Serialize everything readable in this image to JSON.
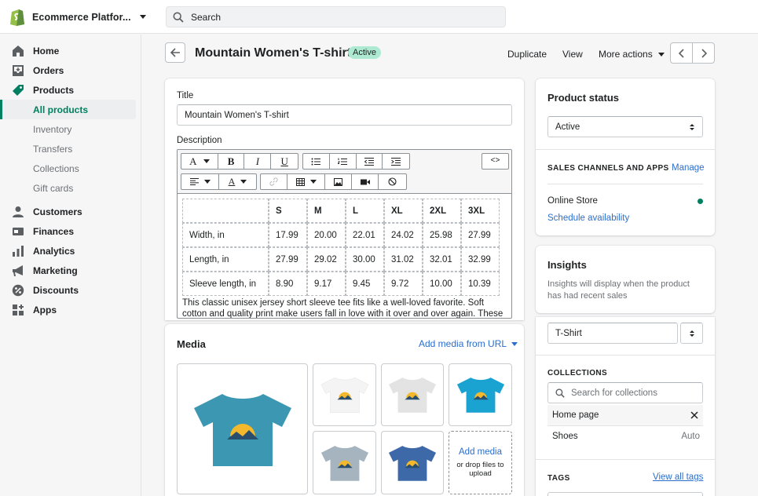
{
  "store": {
    "name": "Ecommerce Platfor..."
  },
  "search": {
    "placeholder": "Search"
  },
  "nav": {
    "home": "Home",
    "orders": "Orders",
    "products": "Products",
    "all_products": "All products",
    "inventory": "Inventory",
    "transfers": "Transfers",
    "collections": "Collections",
    "gift_cards": "Gift cards",
    "customers": "Customers",
    "finances": "Finances",
    "analytics": "Analytics",
    "marketing": "Marketing",
    "discounts": "Discounts",
    "apps": "Apps"
  },
  "header": {
    "title": "Mountain Women's T-shirt",
    "badge": "Active",
    "duplicate": "Duplicate",
    "view": "View",
    "more_actions": "More actions"
  },
  "product": {
    "title_label": "Title",
    "title_value": "Mountain Women's T-shirt",
    "description_label": "Description",
    "size_table": {
      "headers": [
        "",
        "S",
        "M",
        "L",
        "XL",
        "2XL",
        "3XL"
      ],
      "rows": [
        [
          "Width, in",
          "17.99",
          "20.00",
          "22.01",
          "24.02",
          "25.98",
          "27.99"
        ],
        [
          "Length, in",
          "27.99",
          "29.02",
          "30.00",
          "31.02",
          "32.01",
          "32.99"
        ],
        [
          "Sleeve length, in",
          "8.90",
          "9.17",
          "9.45",
          "9.72",
          "10.00",
          "10.39"
        ]
      ]
    },
    "description_text": "This classic unisex jersey short sleeve tee fits like a well-loved favorite. Soft cotton and quality print make users fall in love with it over and over again. These"
  },
  "media": {
    "heading": "Media",
    "add_from_url": "Add media from URL",
    "add_media": "Add media",
    "drop_files": "or drop files to upload",
    "colors": {
      "main": "#3c97b3",
      "white": "#f4f4f4",
      "grey": "#e3e3e3",
      "turquoise": "#1aa3d0",
      "slate": "#a5b4bf",
      "royal": "#3d69a8"
    }
  },
  "status": {
    "heading": "Product status",
    "value": "Active",
    "sales_channels": "SALES CHANNELS AND APPS",
    "manage": "Manage",
    "online_store": "Online Store",
    "schedule": "Schedule availability",
    "online_color": "#008060"
  },
  "insights": {
    "heading": "Insights",
    "text": "Insights will display when the product has had recent sales"
  },
  "organization": {
    "type_value": "T-Shirt",
    "collections_heading": "COLLECTIONS",
    "search_placeholder": "Search for collections",
    "collections": [
      {
        "name": "Home page",
        "meta": ""
      },
      {
        "name": "Shoes",
        "meta": "Auto"
      }
    ],
    "tags_heading": "TAGS",
    "view_all_tags": "View all tags"
  },
  "colors": {
    "accent": "#008060",
    "link": "#2c6ecb",
    "badge": "#aee9d1"
  }
}
